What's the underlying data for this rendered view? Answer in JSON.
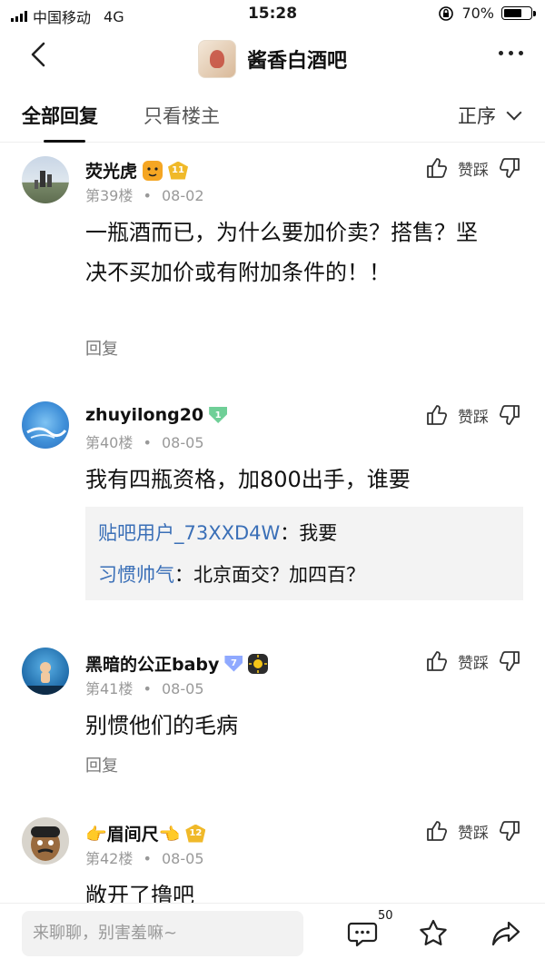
{
  "status": {
    "carrier": "中国移动",
    "network": "4G",
    "time": "15:28",
    "battery": "70%",
    "battery_level": 0.7
  },
  "header": {
    "forum_name": "酱香白酒吧",
    "back_icon": "chevron-left-icon",
    "more_icon": "more-dots-icon"
  },
  "tabs": {
    "all": "全部回复",
    "owner_only": "只看楼主",
    "sort": "正序"
  },
  "actions": {
    "vote_label": "赞踩",
    "reply": "回复"
  },
  "posts": [
    {
      "user": "荧光虎",
      "level": "11",
      "floor": "第39楼",
      "date": "08-02",
      "content": "一瓶酒而已，为什么要加价卖？搭售？坚决不买加价或有附加条件的！！",
      "has_reply": true
    },
    {
      "user": "zhuyilong20",
      "level": "1",
      "floor": "第40楼",
      "date": "08-05",
      "content": "我有四瓶资格，加800出手，谁要",
      "sub": [
        {
          "user": "贴吧用户_73XXD4W",
          "sep": "：",
          "text": "我要"
        },
        {
          "user": "习惯帅气",
          "sep": "：",
          "text": "北京面交？加四百？"
        }
      ]
    },
    {
      "user": "黑暗的公正baby",
      "level": "7",
      "floor": "第41楼",
      "date": "08-05",
      "content": "别惯他们的毛病",
      "has_reply": true
    },
    {
      "user": "👉眉间尺👈",
      "level": "12",
      "floor": "第42楼",
      "date": "08-05",
      "content": "敞开了撸吧"
    }
  ],
  "footer": {
    "placeholder": "来聊聊，别害羞嘛~",
    "comment_count": "50",
    "comment_icon": "comment-icon",
    "star_icon": "star-icon",
    "share_icon": "share-icon"
  },
  "separator": "•"
}
